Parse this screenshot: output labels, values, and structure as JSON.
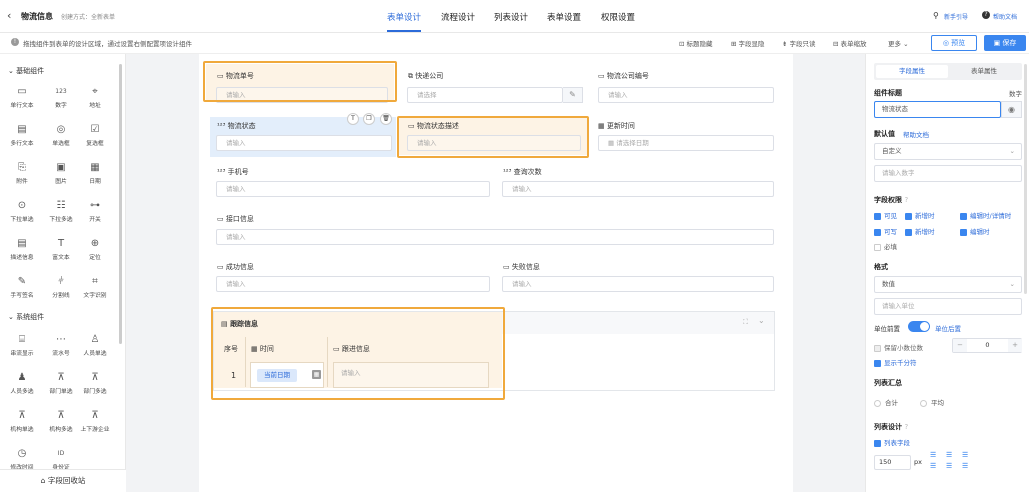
{
  "header": {
    "title": "物流信息",
    "create_mode": "创建方式：全新表单",
    "tabs": [
      "表单设计",
      "流程设计",
      "列表设计",
      "表单设置",
      "权限设置"
    ],
    "guide": "新手引导",
    "help": "帮助文档"
  },
  "subbar": {
    "hint": "拖拽组件到表单的设计区域，通过设置右侧配置项设计组件",
    "tools": [
      "标题隐藏",
      "字段显隐",
      "字段只读",
      "表单缩放",
      "更多"
    ],
    "preview": "预览",
    "save": "保存"
  },
  "left": {
    "section_basic": "基础组件",
    "basic": [
      "单行文本",
      "数字",
      "地址",
      "多行文本",
      "单选框",
      "复选框",
      "附件",
      "图片",
      "日期",
      "下拉单选",
      "下拉多选",
      "开关",
      "描述信息",
      "富文本",
      "定位",
      "手写签名",
      "分割线",
      "文字识别"
    ],
    "section_system": "系统组件",
    "system": [
      "串流显示",
      "流水号",
      "人员单选",
      "人员多选",
      "部门单选",
      "部门多选",
      "机构单选",
      "机构多选",
      "上下游企业",
      "修改时间",
      "身份证"
    ],
    "recycle": "字段回收站"
  },
  "form": {
    "f_order_no": "物流单号",
    "f_express": "快递公司",
    "f_company_no": "物流公司编号",
    "f_status": "物流状态",
    "f_status_desc": "物流状态描述",
    "f_update_time": "更新时间",
    "f_phone": "手机号",
    "f_query_count": "查询次数",
    "f_api_info": "接口信息",
    "f_success_info": "成功信息",
    "f_fail_info": "失败信息",
    "ph_input": "请输入",
    "ph_select": "请选择",
    "ph_date": "请选择日期",
    "subform_title": "跟踪信息",
    "col_index": "序号",
    "col_time": "时间",
    "col_track": "跟进信息",
    "row_index": "1",
    "current_date": "当前日期"
  },
  "right": {
    "tab_field": "字段属性",
    "tab_form": "表单属性",
    "title_label": "组件标题",
    "title_type": "数字",
    "title_value": "物流状态",
    "default_label": "默认值",
    "default_help": "帮助文档",
    "default_value": "自定义",
    "default_ph": "请输入数字",
    "perm_label": "字段权限",
    "perm_row1": [
      "可见",
      "新增时",
      "编辑时/详情时"
    ],
    "perm_row2": [
      "可写",
      "新增时",
      "编辑时"
    ],
    "required": "必填",
    "format_label": "格式",
    "format_value": "数值",
    "unit_ph": "请输入单位",
    "unit_before": "单位前置",
    "unit_after": "单位后置",
    "decimals": "保留小数位数",
    "decimals_value": "0",
    "thousands": "显示千分符",
    "summary_label": "列表汇总",
    "sum": "合计",
    "avg": "平均",
    "list_design": "列表设计",
    "list_field": "列表字段",
    "width_value": "150",
    "width_unit": "px"
  }
}
